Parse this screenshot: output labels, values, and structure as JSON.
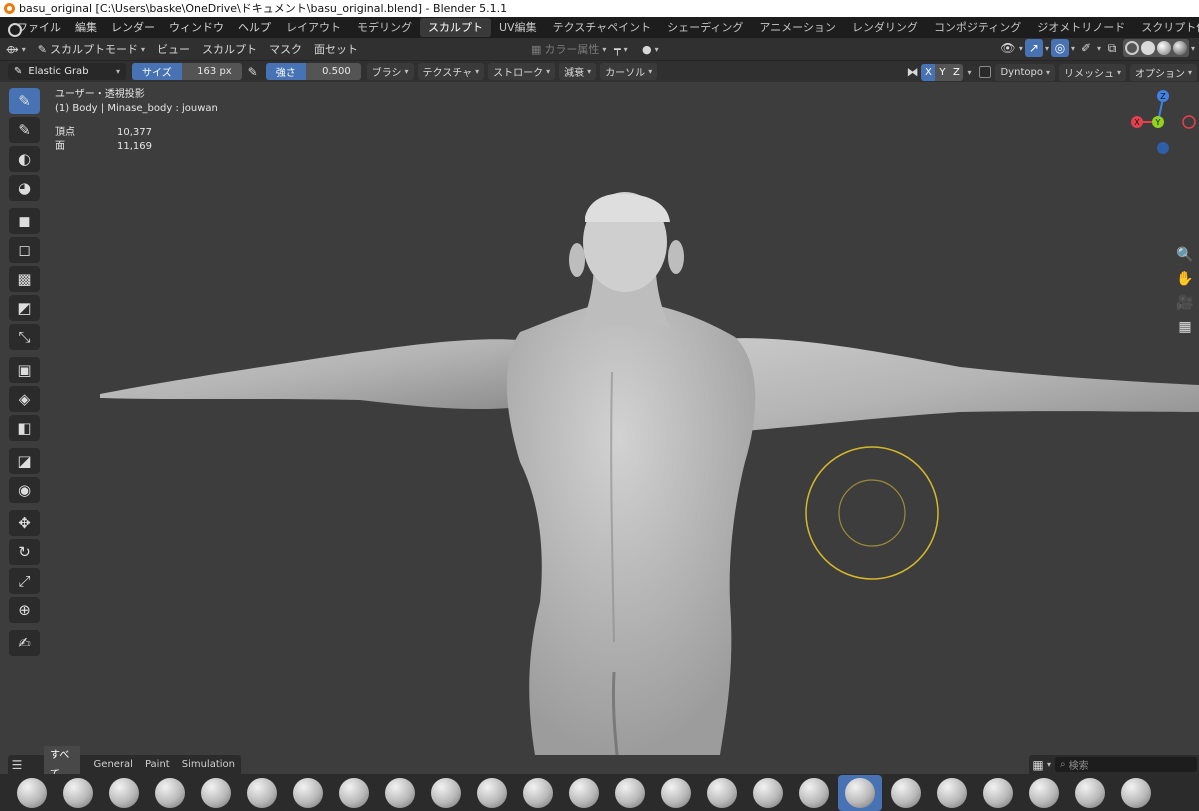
{
  "window": {
    "title": "basu_original [C:\\Users\\baske\\OneDrive\\ドキュメント\\basu_original.blend] - Blender 5.1.1"
  },
  "menubar": {
    "items": [
      "ファイル",
      "編集",
      "レンダー",
      "ウィンドウ",
      "ヘルプ"
    ],
    "workspaces": [
      "レイアウト",
      "モデリング",
      "スカルプト",
      "UV編集",
      "テクスチャペイント",
      "シェーディング",
      "アニメーション",
      "レンダリング",
      "コンポジティング",
      "ジオメトリノード",
      "スクリプト作成"
    ],
    "active_workspace": "スカルプト",
    "add_label": "+"
  },
  "header": {
    "mode": "スカルプトモード",
    "menus": [
      "ビュー",
      "スカルプト",
      "マスク",
      "面セット"
    ],
    "color_attribute": "カラー属性"
  },
  "tool_settings": {
    "brush_name": "Elastic Grab",
    "size_label": "サイズ",
    "size_value": "163 px",
    "strength_label": "強さ",
    "strength_value": "0.500",
    "menus": [
      "ブラシ",
      "テクスチャ",
      "ストローク",
      "減衰",
      "カーソル"
    ],
    "axes": [
      "X",
      "Y",
      "Z"
    ],
    "dyntopo": "Dyntopo",
    "remesh": "リメッシュ",
    "options": "オプション"
  },
  "viewport": {
    "view_label": "ユーザー・透視投影",
    "object_label": "(1) Body | Minase_body : jouwan",
    "stats": [
      {
        "label": "頂点",
        "value": "10,377"
      },
      {
        "label": "面",
        "value": "11,169"
      }
    ],
    "gizmo": {
      "x": "X",
      "y": "Y",
      "z": "Z"
    },
    "colors": {
      "x_axis": "#e5414d",
      "y_axis": "#8fd41e",
      "z_axis": "#3f83e4",
      "brush_cursor": "#d4b82a",
      "active_blue": "#4772b3"
    }
  },
  "toolbar": {
    "icons": [
      "draw-brush-icon",
      "smooth-brush-icon",
      "pinch-brush-icon",
      "paint-brush-icon",
      "box-mask-icon",
      "box-hide-icon",
      "box-face-set-icon",
      "box-trim-icon",
      "line-project-icon",
      "mesh-filter-icon",
      "cloth-filter-icon",
      "color-filter-icon",
      "edit-face-set-icon",
      "mask-by-color-icon",
      "move-icon",
      "rotate-icon",
      "scale-icon",
      "transform-icon",
      "annotate-icon"
    ]
  },
  "asset_shelf": {
    "tabs": [
      "すべて",
      "General",
      "Paint",
      "Simulation"
    ],
    "active_tab": "すべて",
    "search_placeholder": "検索",
    "brush_count": 25,
    "active_brush_index": 18
  }
}
